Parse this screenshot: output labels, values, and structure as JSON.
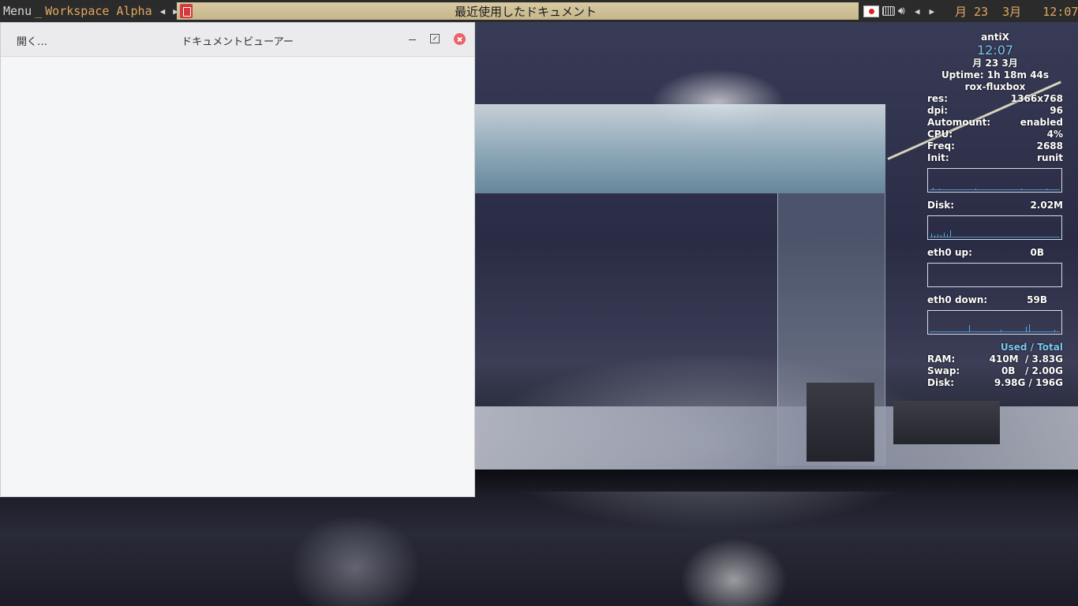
{
  "taskbar": {
    "menu_label": "Menu",
    "separator": "_",
    "workspace": "Workspace Alpha",
    "prev_arrow": "◀",
    "next_arrow": "▶",
    "active_task_title": "最近使用したドキュメント",
    "tray_prev": "◀",
    "tray_next": "▶",
    "clock_text": "月 23  3月   12:07",
    "accent_color": "#e0a860"
  },
  "viewer": {
    "open_label": "開く…",
    "title": "ドキュメントビューアー"
  },
  "conky": {
    "hostname": "antiX",
    "clock": "12:07",
    "date": "月 23  3月",
    "uptime": "Uptime: 1h 18m 44s",
    "session": "rox-fluxbox",
    "rows": [
      {
        "label": "res:",
        "value": "1366x768"
      },
      {
        "label": "dpi:",
        "value": "96"
      },
      {
        "label": "Automount:",
        "value": "enabled"
      },
      {
        "label": "CPU:",
        "value": "4%"
      },
      {
        "label": "Freq:",
        "value": "2688"
      },
      {
        "label": "Init:",
        "value": "runit"
      }
    ],
    "disk_label": "Disk:",
    "disk_value": "2.02M",
    "eth0_up_label": "eth0 up:",
    "eth0_up_value": "0B",
    "eth0_down_label": "eth0 down:",
    "eth0_down_value": "59B",
    "used_total": "Used / Total",
    "memory": [
      {
        "label": "RAM:",
        "value": "410M  / 3.83G"
      },
      {
        "label": "Swap:",
        "value": "0B   / 2.00G"
      },
      {
        "label": "Disk:",
        "value": "9.98G / 196G"
      }
    ],
    "accent_color": "#7ec8f0"
  }
}
